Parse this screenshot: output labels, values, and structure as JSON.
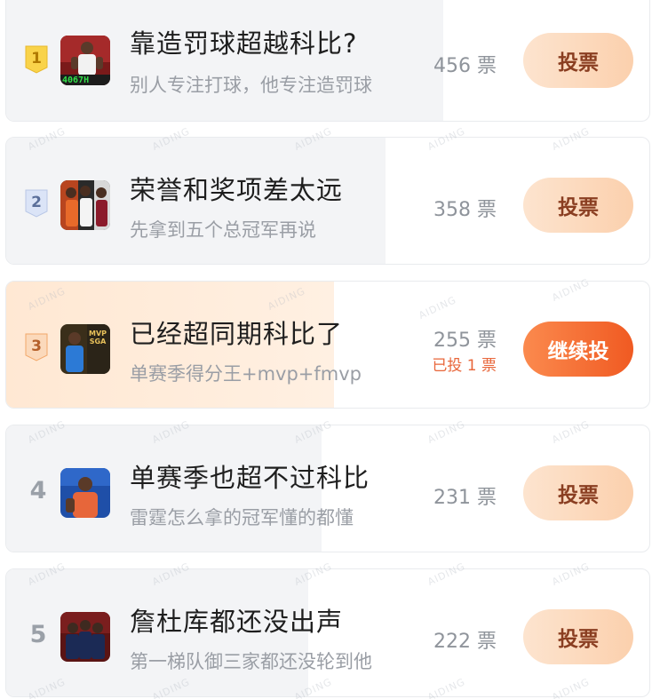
{
  "watermark_text": "AIDING",
  "colors": {
    "accent": "#f05a22",
    "gold": "#f7c948",
    "silver": "#b8c6e6",
    "bronze": "#f2a86a"
  },
  "items": [
    {
      "rank": "1",
      "title": "靠造罚球超越科比?",
      "subtitle": "别人专注打球，他专注造罚球",
      "votes": "456 票",
      "vote_share": 0.68,
      "button_label": "投票",
      "thumb_caption": "4067H",
      "voted_note": ""
    },
    {
      "rank": "2",
      "title": "荣誉和奖项差太远",
      "subtitle": "先拿到五个总冠军再说",
      "votes": "358 票",
      "vote_share": 0.59,
      "button_label": "投票",
      "thumb_caption": "",
      "voted_note": ""
    },
    {
      "rank": "3",
      "title": "已经超同期科比了",
      "subtitle": "单赛季得分王+mvp+fmvp",
      "votes": "255 票",
      "vote_share": 0.51,
      "button_label": "继续投",
      "thumb_caption": "MVP SGA",
      "voted_note": "已投 1 票"
    },
    {
      "rank": "4",
      "title": "单赛季也超不过科比",
      "subtitle": "雷霆怎么拿的冠军懂的都懂",
      "votes": "231 票",
      "vote_share": 0.49,
      "button_label": "投票",
      "thumb_caption": "",
      "voted_note": ""
    },
    {
      "rank": "5",
      "title": "詹杜库都还没出声",
      "subtitle": "第一梯队御三家都还没轮到他",
      "votes": "222 票",
      "vote_share": 0.47,
      "button_label": "投票",
      "thumb_caption": "",
      "voted_note": ""
    }
  ]
}
